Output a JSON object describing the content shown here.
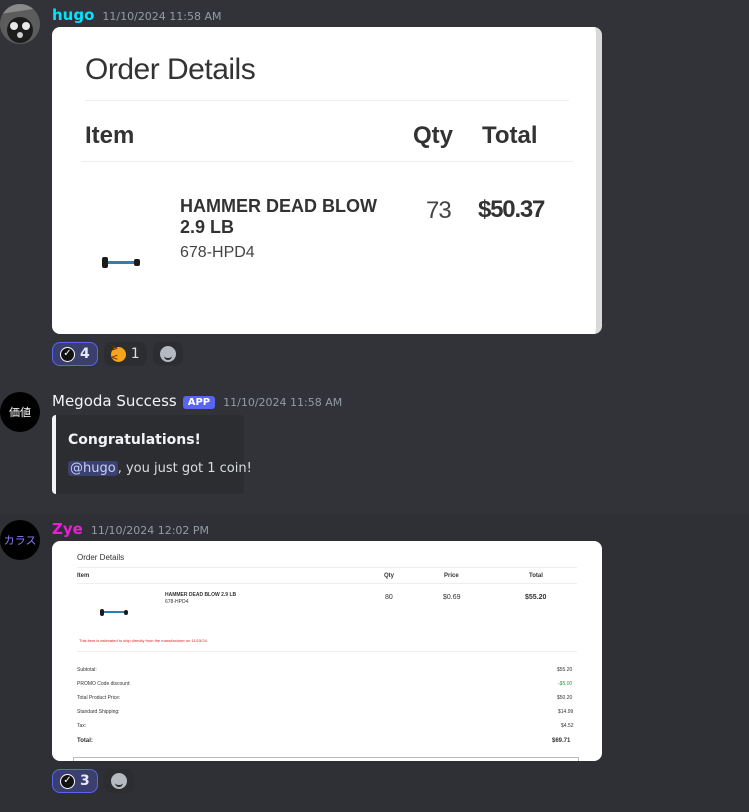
{
  "messages": [
    {
      "user": "hugo",
      "user_color": "#00e5ff",
      "timestamp": "11/10/2024 11:58 AM",
      "order": {
        "title": "Order Details",
        "headers": {
          "item": "Item",
          "qty": "Qty",
          "total": "Total"
        },
        "product_name_line1": "HAMMER DEAD BLOW",
        "product_name_line2": "2.9 LB",
        "sku": "678-HPD4",
        "qty": "73",
        "total": "$50.37"
      },
      "reactions": [
        {
          "emoji": "check-badge-icon",
          "count": "4",
          "active": true
        },
        {
          "emoji": "angry-face-icon",
          "count": "1",
          "active": false
        }
      ]
    },
    {
      "user": "Megoda Success",
      "user_color": "#f2f3f5",
      "badge": "APP",
      "avatar_text": "価値",
      "timestamp": "11/10/2024 11:58 AM",
      "embed": {
        "title": "Congratulations!",
        "mention": "@hugo",
        "text": ", you just got 1 coin!"
      }
    },
    {
      "user": "Zye",
      "user_color": "#e91ed6",
      "avatar_text": "カラス",
      "timestamp": "11/10/2024 12:02 PM",
      "order": {
        "title": "Order Details",
        "headers": {
          "item": "Item",
          "qty": "Qty",
          "price": "Price",
          "total": "Total"
        },
        "product_name": "HAMMER DEAD BLOW 2.9 LB",
        "sku": "678-HPD4",
        "qty": "80",
        "price": "$0.69",
        "total": "$55.20",
        "notice": "This item is estimated to ship directly from the manufacturer on 11/15/24.",
        "summary": [
          {
            "label": "Subtotal:",
            "value": "$55.20"
          },
          {
            "label": "PROMO Code discount:",
            "value": "-$5.00"
          },
          {
            "label": "Total Product Price:",
            "value": "$50.20"
          },
          {
            "label": "Standard Shipping:",
            "value": "$14.99"
          },
          {
            "label": "Tax:",
            "value": "$4.52"
          },
          {
            "label": "Total:",
            "value": "$69.71"
          }
        ]
      },
      "reactions": [
        {
          "emoji": "check-badge-icon",
          "count": "3",
          "active": true
        }
      ]
    }
  ]
}
